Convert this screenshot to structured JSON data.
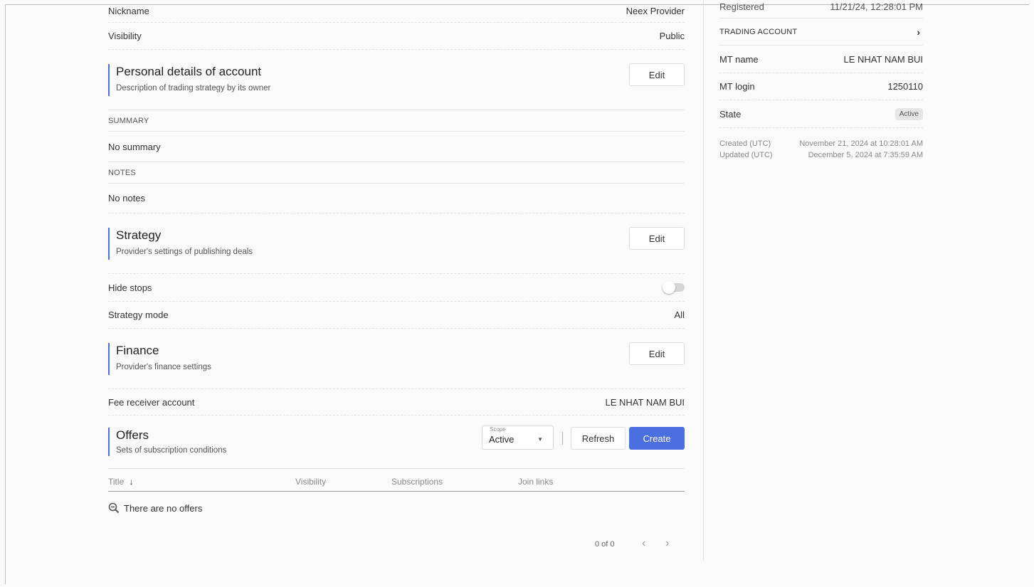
{
  "main": {
    "nickname_label": "Nickname",
    "nickname_value": "Neex Provider",
    "visibility_label": "Visibility",
    "visibility_value": "Public",
    "personal": {
      "title": "Personal details of account",
      "subtitle": "Description of trading strategy by its owner",
      "edit_label": "Edit"
    },
    "summary_header": "SUMMARY",
    "summary_value": "No summary",
    "notes_header": "NOTES",
    "notes_value": "No notes",
    "strategy": {
      "title": "Strategy",
      "subtitle": "Provider's settings of publishing deals",
      "edit_label": "Edit",
      "hide_stops_label": "Hide stops",
      "hide_stops_enabled": false,
      "mode_label": "Strategy mode",
      "mode_value": "All"
    },
    "finance": {
      "title": "Finance",
      "subtitle": "Provider's finance settings",
      "edit_label": "Edit",
      "fee_label": "Fee receiver account",
      "fee_value": "LE NHAT NAM BUI"
    },
    "offers": {
      "title": "Offers",
      "subtitle": "Sets of subscription conditions",
      "scope_label": "Scope",
      "scope_value": "Active",
      "refresh_label": "Refresh",
      "create_label": "Create",
      "columns": [
        "Title",
        "Visibility",
        "Subscriptions",
        "Join links"
      ],
      "sort_arrow": "↓",
      "empty_text": "There are no offers",
      "pagination": "0 of 0"
    }
  },
  "sidebar": {
    "registered_label": "Registered",
    "registered_value": "11/21/24, 12:28:01 PM",
    "trading_account_header": "TRADING ACCOUNT",
    "mt_name_label": "MT name",
    "mt_name_value": "LE NHAT NAM BUI",
    "mt_login_label": "MT login",
    "mt_login_value": "1250110",
    "state_label": "State",
    "state_value": "Active",
    "created_label": "Created (UTC)",
    "created_value": "November 21, 2024 at 10:28:01 AM",
    "updated_label": "Updated (UTC)",
    "updated_value": "December 5, 2024 at 7:35:59 AM"
  },
  "colors": {
    "accent": "#4a6fe0",
    "badge_bg": "#e6e6e6"
  }
}
